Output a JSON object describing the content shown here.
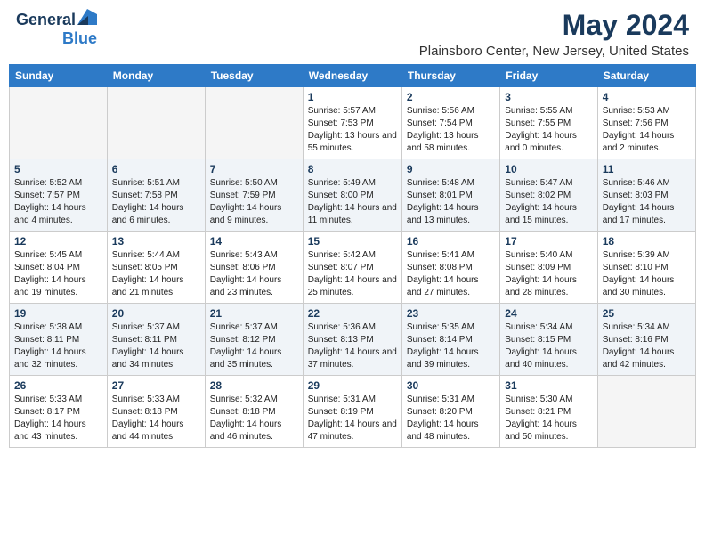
{
  "logo": {
    "general": "General",
    "blue": "Blue"
  },
  "title": "May 2024",
  "subtitle": "Plainsboro Center, New Jersey, United States",
  "days_of_week": [
    "Sunday",
    "Monday",
    "Tuesday",
    "Wednesday",
    "Thursday",
    "Friday",
    "Saturday"
  ],
  "weeks": [
    [
      {
        "day": "",
        "empty": true
      },
      {
        "day": "",
        "empty": true
      },
      {
        "day": "",
        "empty": true
      },
      {
        "day": "1",
        "sunrise": "5:57 AM",
        "sunset": "7:53 PM",
        "daylight": "13 hours and 55 minutes."
      },
      {
        "day": "2",
        "sunrise": "5:56 AM",
        "sunset": "7:54 PM",
        "daylight": "13 hours and 58 minutes."
      },
      {
        "day": "3",
        "sunrise": "5:55 AM",
        "sunset": "7:55 PM",
        "daylight": "14 hours and 0 minutes."
      },
      {
        "day": "4",
        "sunrise": "5:53 AM",
        "sunset": "7:56 PM",
        "daylight": "14 hours and 2 minutes."
      }
    ],
    [
      {
        "day": "5",
        "sunrise": "5:52 AM",
        "sunset": "7:57 PM",
        "daylight": "14 hours and 4 minutes."
      },
      {
        "day": "6",
        "sunrise": "5:51 AM",
        "sunset": "7:58 PM",
        "daylight": "14 hours and 6 minutes."
      },
      {
        "day": "7",
        "sunrise": "5:50 AM",
        "sunset": "7:59 PM",
        "daylight": "14 hours and 9 minutes."
      },
      {
        "day": "8",
        "sunrise": "5:49 AM",
        "sunset": "8:00 PM",
        "daylight": "14 hours and 11 minutes."
      },
      {
        "day": "9",
        "sunrise": "5:48 AM",
        "sunset": "8:01 PM",
        "daylight": "14 hours and 13 minutes."
      },
      {
        "day": "10",
        "sunrise": "5:47 AM",
        "sunset": "8:02 PM",
        "daylight": "14 hours and 15 minutes."
      },
      {
        "day": "11",
        "sunrise": "5:46 AM",
        "sunset": "8:03 PM",
        "daylight": "14 hours and 17 minutes."
      }
    ],
    [
      {
        "day": "12",
        "sunrise": "5:45 AM",
        "sunset": "8:04 PM",
        "daylight": "14 hours and 19 minutes."
      },
      {
        "day": "13",
        "sunrise": "5:44 AM",
        "sunset": "8:05 PM",
        "daylight": "14 hours and 21 minutes."
      },
      {
        "day": "14",
        "sunrise": "5:43 AM",
        "sunset": "8:06 PM",
        "daylight": "14 hours and 23 minutes."
      },
      {
        "day": "15",
        "sunrise": "5:42 AM",
        "sunset": "8:07 PM",
        "daylight": "14 hours and 25 minutes."
      },
      {
        "day": "16",
        "sunrise": "5:41 AM",
        "sunset": "8:08 PM",
        "daylight": "14 hours and 27 minutes."
      },
      {
        "day": "17",
        "sunrise": "5:40 AM",
        "sunset": "8:09 PM",
        "daylight": "14 hours and 28 minutes."
      },
      {
        "day": "18",
        "sunrise": "5:39 AM",
        "sunset": "8:10 PM",
        "daylight": "14 hours and 30 minutes."
      }
    ],
    [
      {
        "day": "19",
        "sunrise": "5:38 AM",
        "sunset": "8:11 PM",
        "daylight": "14 hours and 32 minutes."
      },
      {
        "day": "20",
        "sunrise": "5:37 AM",
        "sunset": "8:11 PM",
        "daylight": "14 hours and 34 minutes."
      },
      {
        "day": "21",
        "sunrise": "5:37 AM",
        "sunset": "8:12 PM",
        "daylight": "14 hours and 35 minutes."
      },
      {
        "day": "22",
        "sunrise": "5:36 AM",
        "sunset": "8:13 PM",
        "daylight": "14 hours and 37 minutes."
      },
      {
        "day": "23",
        "sunrise": "5:35 AM",
        "sunset": "8:14 PM",
        "daylight": "14 hours and 39 minutes."
      },
      {
        "day": "24",
        "sunrise": "5:34 AM",
        "sunset": "8:15 PM",
        "daylight": "14 hours and 40 minutes."
      },
      {
        "day": "25",
        "sunrise": "5:34 AM",
        "sunset": "8:16 PM",
        "daylight": "14 hours and 42 minutes."
      }
    ],
    [
      {
        "day": "26",
        "sunrise": "5:33 AM",
        "sunset": "8:17 PM",
        "daylight": "14 hours and 43 minutes."
      },
      {
        "day": "27",
        "sunrise": "5:33 AM",
        "sunset": "8:18 PM",
        "daylight": "14 hours and 44 minutes."
      },
      {
        "day": "28",
        "sunrise": "5:32 AM",
        "sunset": "8:18 PM",
        "daylight": "14 hours and 46 minutes."
      },
      {
        "day": "29",
        "sunrise": "5:31 AM",
        "sunset": "8:19 PM",
        "daylight": "14 hours and 47 minutes."
      },
      {
        "day": "30",
        "sunrise": "5:31 AM",
        "sunset": "8:20 PM",
        "daylight": "14 hours and 48 minutes."
      },
      {
        "day": "31",
        "sunrise": "5:30 AM",
        "sunset": "8:21 PM",
        "daylight": "14 hours and 50 minutes."
      },
      {
        "day": "",
        "empty": true
      }
    ]
  ],
  "labels": {
    "sunrise": "Sunrise:",
    "sunset": "Sunset:",
    "daylight": "Daylight:"
  }
}
